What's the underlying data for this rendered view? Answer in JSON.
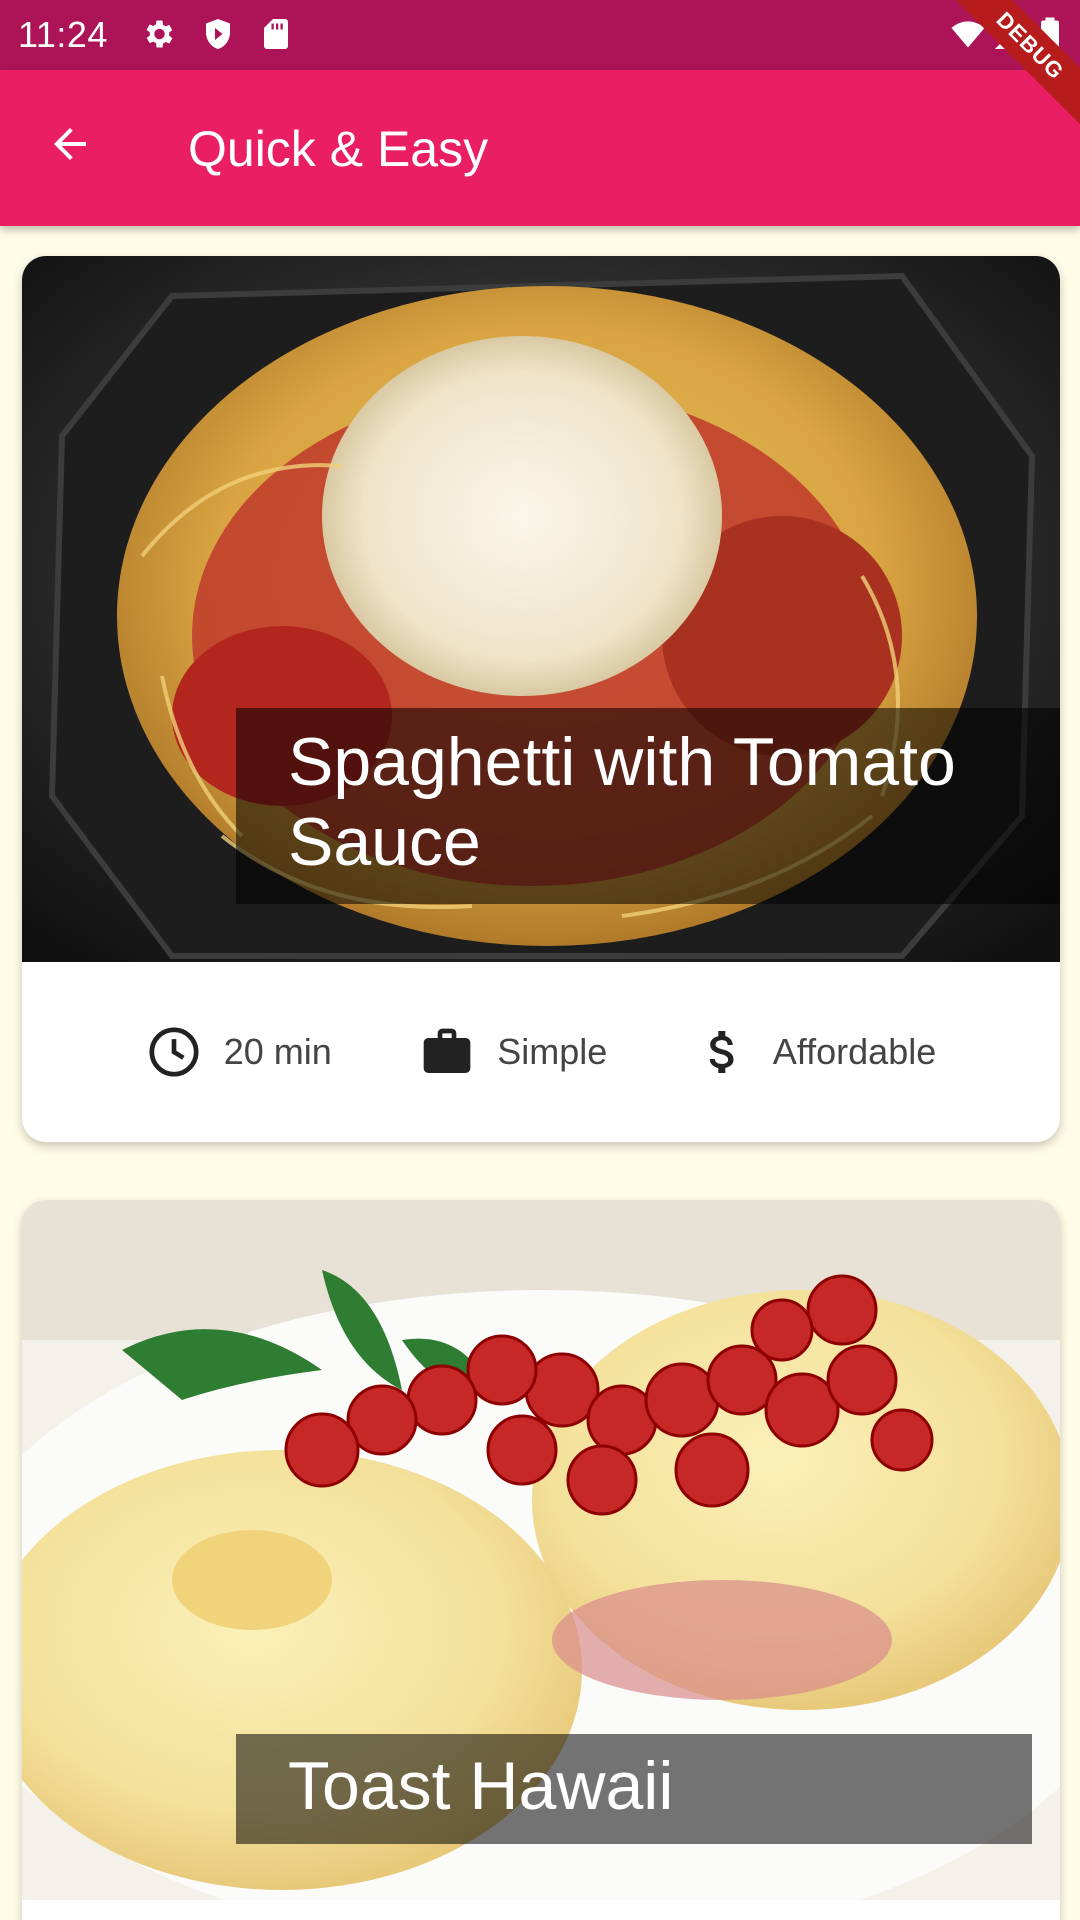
{
  "status_bar": {
    "time": "11:24",
    "icons": [
      "settings-icon",
      "shield-icon",
      "sim-card-icon",
      "wifi-icon",
      "signal-icon",
      "battery-icon"
    ]
  },
  "debug_banner": "DEBUG",
  "app_bar": {
    "title": "Quick & Easy",
    "back_icon": "arrow-back-icon"
  },
  "meals": [
    {
      "title": "Spaghetti with Tomato Sauce",
      "duration": "20 min",
      "complexity": "Simple",
      "affordability": "Affordable",
      "image": "spaghetti-photo"
    },
    {
      "title": "Toast Hawaii",
      "image": "toast-hawaii-photo"
    }
  ],
  "colors": {
    "status_bar": "#ad1457",
    "app_bar": "#e91e63",
    "background": "#fffde7"
  }
}
